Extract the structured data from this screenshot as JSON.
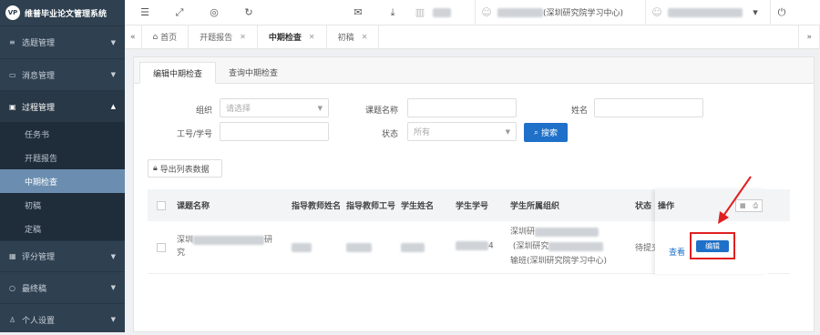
{
  "app": {
    "title": "维普毕业论文管理系统",
    "logo_text": "VP"
  },
  "sidebar": {
    "items": [
      {
        "label": "选题管理",
        "icon": "list-icon"
      },
      {
        "label": "消息管理",
        "icon": "message-icon"
      },
      {
        "label": "过程管理",
        "icon": "book-icon"
      },
      {
        "label": "评分管理",
        "icon": "score-icon"
      },
      {
        "label": "最终稿",
        "icon": "circle-icon"
      },
      {
        "label": "个人设置",
        "icon": "user-icon"
      }
    ],
    "sub_items": [
      "任务书",
      "开题报告",
      "中期检查",
      "初稿",
      "定稿"
    ]
  },
  "topbar": {
    "org_text": "(深圳研究院学习中心)"
  },
  "tabs": [
    "首页",
    "开题报告",
    "中期检查",
    "初稿"
  ],
  "subtabs": [
    "编辑中期检查",
    "查询中期检查"
  ],
  "form": {
    "org_label": "组织",
    "org_placeholder": "请选择",
    "topic_label": "课题名称",
    "name_label": "姓名",
    "id_label": "工号/学号",
    "status_label": "状态",
    "status_value": "所有",
    "search_label": "搜索"
  },
  "export_label": "导出列表数据",
  "table": {
    "headers": [
      "课题名称",
      "指导教师姓名",
      "指导教师工号",
      "学生姓名",
      "学生学号",
      "学生所属组织",
      "状态",
      "操作"
    ],
    "row": {
      "topic_prefix": "深圳",
      "topic_suffix": "研",
      "topic_line2": "究",
      "sid_tail": "4",
      "org_line1": "深圳研",
      "org_line2": "(深圳研究",
      "org_line3": "输班(深圳研究院学习中心)",
      "status": "待提交",
      "view": "查看",
      "edit": "编辑"
    }
  },
  "colors": {
    "sidebar": "#2f4050",
    "accent": "#1e70c8",
    "highlight": "#e02020"
  }
}
